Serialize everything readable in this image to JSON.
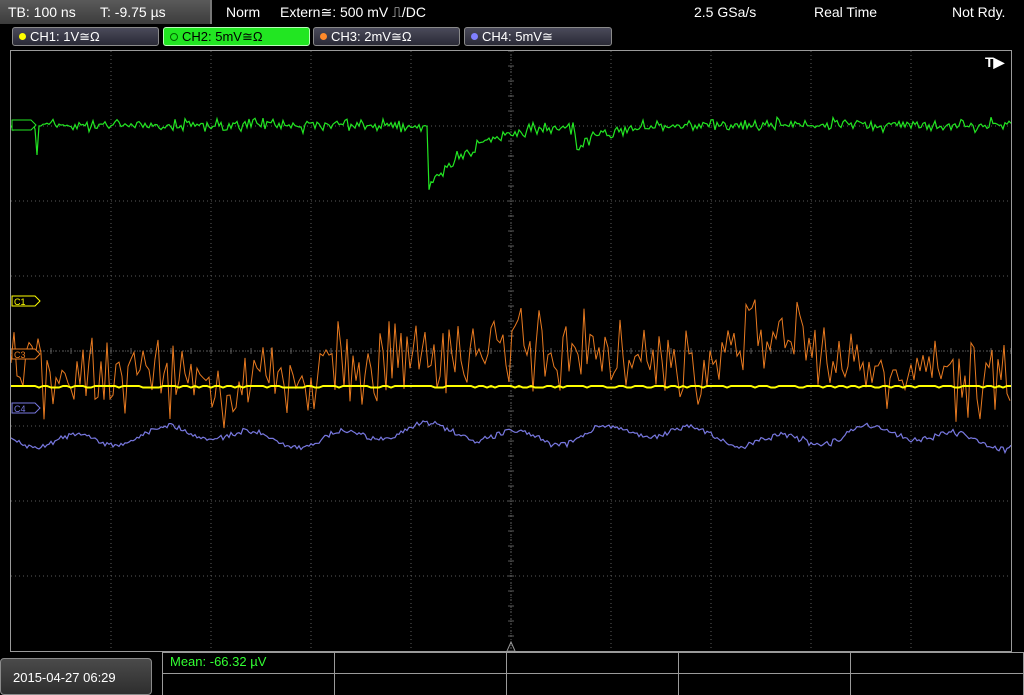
{
  "status": {
    "timebase": "TB: 100 ns",
    "trigger_time": "T: -9.75 µs",
    "mode": "Norm",
    "trigger_source": "Extern≅: 500 mV ⎍/DC",
    "sample_rate": "2.5 GSa/s",
    "acq_mode": "Real Time",
    "ready_status": "Not Rdy."
  },
  "channels": [
    {
      "label": "CH1: 1V≅Ω",
      "color": "#ffff00",
      "active": false
    },
    {
      "label": "CH2: 5mV≅Ω",
      "color": "#22e622",
      "active": true
    },
    {
      "label": "CH3: 2mV≅Ω",
      "color": "#ff8a2a",
      "active": false
    },
    {
      "label": "CH4: 5mV≅",
      "color": "#8080ff",
      "active": false
    }
  ],
  "markers": {
    "trigger": "T▶",
    "c1": "C1",
    "c3": "C3",
    "c4": "C4"
  },
  "footer": {
    "datetime": "2015-04-27 06:29",
    "measurement": "Mean: -66.32 µV"
  },
  "colors": {
    "ch1": "#ffff00",
    "ch2": "#22e622",
    "ch3": "#e87a20",
    "ch4": "#7878e0",
    "grid": "#5a5a5a"
  }
}
